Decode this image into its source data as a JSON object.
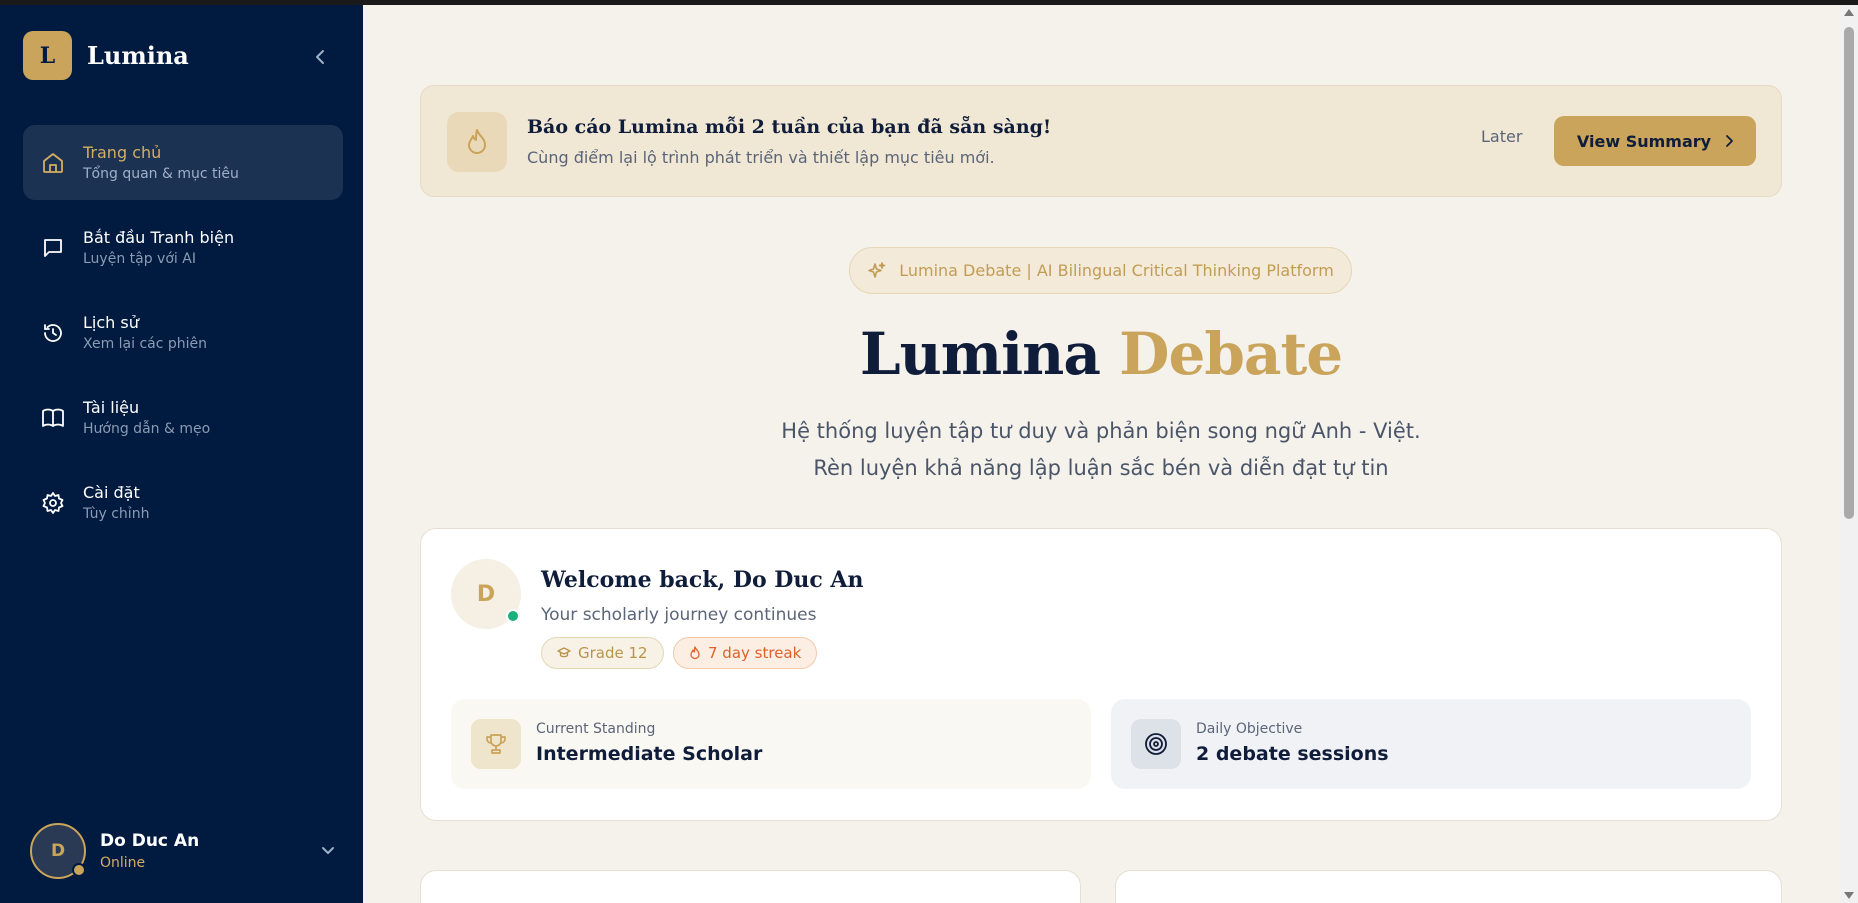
{
  "brand": {
    "logo_letter": "L",
    "name": "Lumina"
  },
  "sidebar": {
    "items": [
      {
        "label": "Trang chủ",
        "sub": "Tổng quan & mục tiêu",
        "icon": "home-icon",
        "active": true
      },
      {
        "label": "Bắt đầu Tranh biện",
        "sub": "Luyện tập với AI",
        "icon": "chat-icon",
        "active": false
      },
      {
        "label": "Lịch sử",
        "sub": "Xem lại các phiên",
        "icon": "history-icon",
        "active": false
      },
      {
        "label": "Tài liệu",
        "sub": "Hướng dẫn & mẹo",
        "icon": "book-icon",
        "active": false
      },
      {
        "label": "Cài đặt",
        "sub": "Tùy chỉnh",
        "icon": "gear-icon",
        "active": false
      }
    ],
    "user": {
      "initial": "D",
      "name": "Do Duc An",
      "status": "Online"
    }
  },
  "banner": {
    "title": "Báo cáo Lumina mỗi 2 tuần của bạn đã sẵn sàng!",
    "subtitle": "Cùng điểm lại lộ trình phát triển và thiết lập mục tiêu mới.",
    "later_label": "Later",
    "view_label": "View Summary"
  },
  "hero": {
    "pill": "Lumina Debate | AI Bilingual Critical Thinking Platform",
    "title_part1": "Lumina",
    "title_part2": "Debate",
    "sub_line1": "Hệ thống luyện tập tư duy và phản biện song ngữ Anh - Việt.",
    "sub_line2": "Rèn luyện khả năng lập luận sắc bén và diễn đạt tự tin"
  },
  "welcome": {
    "initial": "D",
    "title": "Welcome back, Do Duc An",
    "subtitle": "Your scholarly journey continues",
    "grade_badge": "Grade 12",
    "streak_badge": "7 day streak",
    "standing_label": "Current Standing",
    "standing_value": "Intermediate Scholar",
    "objective_label": "Daily Objective",
    "objective_value": "2 debate sessions"
  },
  "colors": {
    "navy": "#011a3f",
    "gold": "#c9a45a",
    "cream": "#f5f2ec",
    "online": "#19b07a",
    "streak": "#e0612a"
  }
}
